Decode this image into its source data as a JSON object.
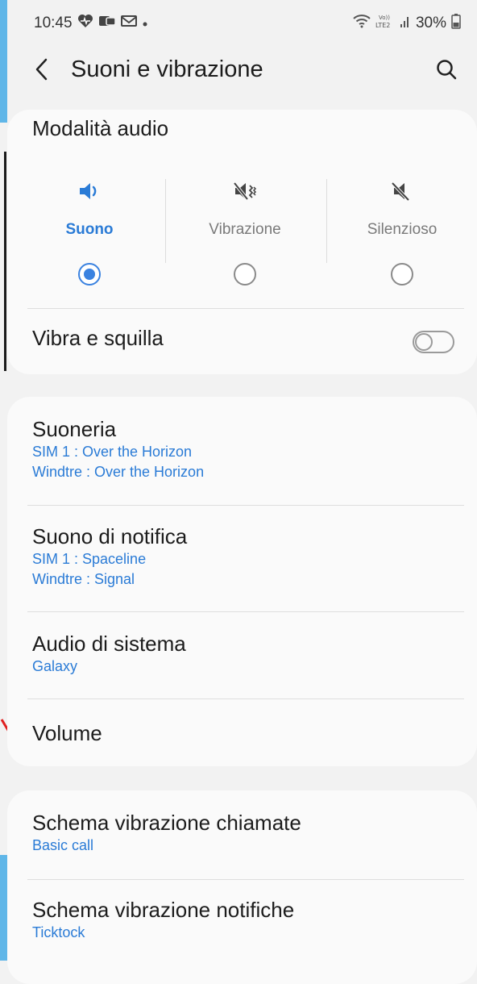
{
  "status_bar": {
    "time": "10:45",
    "battery": "30%",
    "icons": [
      "heart-health-icon",
      "gallery-notification-icon",
      "gmail-icon",
      "dot-icon",
      "wifi-icon",
      "volte-lte2-icon",
      "signal-icon",
      "battery-icon"
    ]
  },
  "app_bar": {
    "title": "Suoni e vibrazione"
  },
  "audio_mode": {
    "title": "Modalità audio",
    "modes": [
      {
        "label": "Suono",
        "icon": "speaker-icon",
        "selected": true
      },
      {
        "label": "Vibrazione",
        "icon": "vibrate-icon",
        "selected": false
      },
      {
        "label": "Silenzioso",
        "icon": "mute-icon",
        "selected": false
      }
    ],
    "vibrate_and_ring": {
      "label": "Vibra e squilla",
      "enabled": false
    }
  },
  "tones": {
    "items": [
      {
        "title": "Suoneria",
        "subs": [
          "SIM 1 : Over the Horizon",
          "Windtre : Over the Horizon"
        ]
      },
      {
        "title": "Suono di notifica",
        "subs": [
          "SIM 1 : Spaceline",
          "Windtre : Signal"
        ]
      },
      {
        "title": "Audio di sistema",
        "subs": [
          "Galaxy"
        ]
      },
      {
        "title": "Volume",
        "subs": []
      }
    ]
  },
  "vibration": {
    "items": [
      {
        "title": "Schema vibrazione chiamate",
        "subs": [
          "Basic call"
        ]
      },
      {
        "title": "Schema vibrazione notifiche",
        "subs": [
          "Ticktock"
        ]
      }
    ]
  },
  "colors": {
    "accent": "#2a7bd6",
    "radio": "#3a82e0",
    "background": "#f2f2f2",
    "card": "#fafafa"
  }
}
